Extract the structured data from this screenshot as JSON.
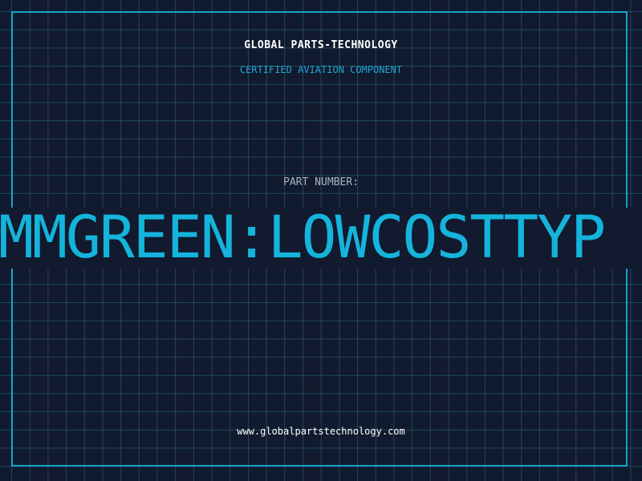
{
  "header": {
    "company": "GLOBAL PARTS-TECHNOLOGY",
    "tagline": "CERTIFIED AVIATION COMPONENT"
  },
  "part": {
    "label": "PART NUMBER:",
    "value": "MMGREEN:LOWCOSTTYP"
  },
  "footer": {
    "url": "www.globalpartstechnology.com"
  },
  "colors": {
    "background": "#111a2e",
    "grid": "#286e82",
    "frame": "#15a5cc",
    "accent": "#14b4dc",
    "heading": "#ffffff",
    "label": "#aab3c2"
  }
}
